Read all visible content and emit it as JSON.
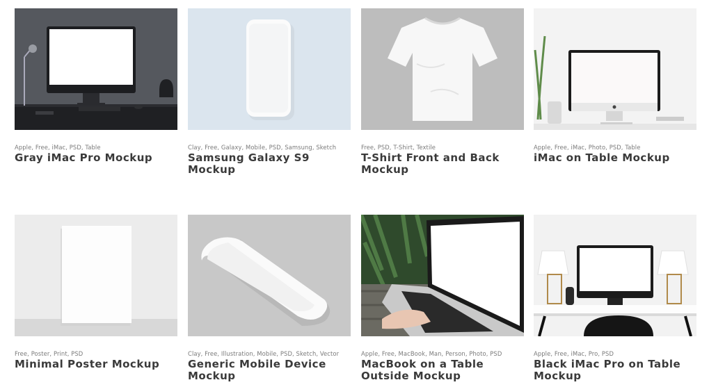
{
  "mockups": [
    {
      "tags": "Apple, Free, iMac, PSD, Table",
      "title": "Gray iMac Pro Mockup",
      "thumb_icon": "imac-desk-thumbnail"
    },
    {
      "tags": "Clay, Free, Galaxy, Mobile, PSD, Samsung, Sketch",
      "title": "Samsung Galaxy S9 Mockup",
      "thumb_icon": "phone-thumbnail"
    },
    {
      "tags": "Free, PSD, T-Shirt, Textile",
      "title": "T-Shirt Front and Back Mockup",
      "thumb_icon": "tshirt-thumbnail"
    },
    {
      "tags": "Apple, Free, iMac, Photo, PSD, Table",
      "title": "iMac on Table Mockup",
      "thumb_icon": "imac-table-thumbnail"
    },
    {
      "tags": "Free, Poster, Print, PSD",
      "title": "Minimal Poster Mockup",
      "thumb_icon": "poster-thumbnail"
    },
    {
      "tags": "Clay, Free, Illustration, Mobile, PSD, Sketch, Vector",
      "title": "Generic Mobile Device Mockup",
      "thumb_icon": "isometric-phone-thumbnail"
    },
    {
      "tags": "Apple, Free, MacBook, Man, Person, Photo, PSD",
      "title": "MacBook on a Table Outside Mockup",
      "thumb_icon": "macbook-outdoor-thumbnail"
    },
    {
      "tags": "Apple, Free, iMac, Pro, PSD",
      "title": "Black iMac Pro on Table Mockup",
      "thumb_icon": "black-imac-desk-thumbnail"
    }
  ],
  "colors": {
    "title_text": "#3a3a3a",
    "tag_text": "#7a7a7a",
    "page_background": "#ffffff"
  }
}
